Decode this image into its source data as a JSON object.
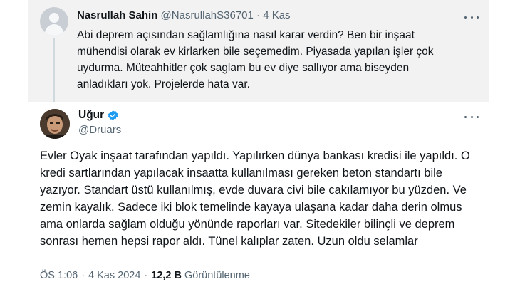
{
  "reply": {
    "display_name": "Nasrullah Sahin",
    "handle": "@NasrullahS36701",
    "separator": "·",
    "time": "4 Kas",
    "text": "Abi deprem açısından sağlamlığına nasıl karar verdin? Ben bir inşaat mühendisi olarak ev kirlarken bile seçemedim. Piyasada yapılan işler çok uydurma. Müteahhitler çok saglam bu ev diye sallıyor ama biseyden anladıkları yok. Projelerde hata var."
  },
  "main": {
    "display_name": "Uğur",
    "handle": "@Druars",
    "text": "Evler Oyak inşaat tarafından yapıldı. Yapılırken dünya bankası kredisi ile yapıldı. O kredi sartlarından yapılacak insaatta kullanılması gereken beton standartı bile yazıyor. Standart üstü kullanılmış, evde duvara civi bile cakılamıyor bu yüzden. Ve zemin kayalık. Sadece iki blok temelinde kayaya ulaşana kadar daha derin olmus ama onlarda sağlam olduğu yönünde raporları var. Sitedekiler bilinçli ve deprem sonrası hemen hepsi rapor aldı. Tünel kalıplar zaten. Uzun oldu selamlar",
    "time": "ÖS 1:06",
    "separator": "·",
    "date": "4 Kas 2024",
    "views_count": "12,2 B",
    "views_label": "Görüntülenme"
  },
  "colors": {
    "reply_background": "#f2f2f2",
    "verified_badge": "#1d9bf0",
    "muted_text": "#536471"
  },
  "icons": [
    "default-avatar-icon",
    "more-options-icon",
    "verified-badge-icon"
  ]
}
